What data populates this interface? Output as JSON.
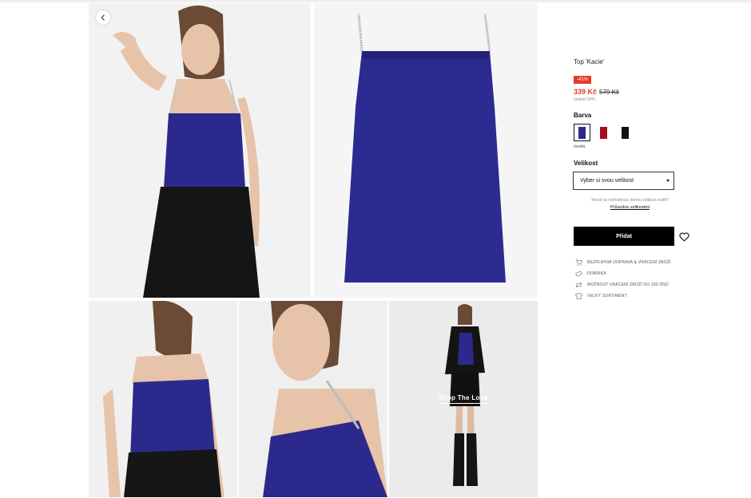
{
  "product": {
    "title": "Top 'Kacie'",
    "discount_badge": "-41%",
    "price_new": "339 Kč",
    "price_old": "579 Kč",
    "vat_note": "včetně DPH.",
    "accent_color": "#e8392b"
  },
  "color": {
    "label": "Barva",
    "selected_name": "modrá",
    "swatches": [
      {
        "name": "modrá",
        "hex": "#2b2a8c"
      },
      {
        "name": "červená",
        "hex": "#a3101c"
      },
      {
        "name": "černá",
        "hex": "#111111"
      }
    ]
  },
  "size": {
    "label": "Velikost",
    "select_value": "Vyber si svou velikost",
    "help_text": "Nevíš se rozhodnout, kterou velikost zvolit?",
    "help_link": "Průvodce velikostmi"
  },
  "actions": {
    "add_label": "Přidat"
  },
  "benefits": [
    {
      "icon": "cart-icon",
      "text": "BEZPLATNÁ DOPRAVA & VRÁCENÍ ZBOŽÍ"
    },
    {
      "icon": "cash-icon",
      "text": "DOBÍRKA"
    },
    {
      "icon": "return-arrows-icon",
      "text": "MOŽNOST VRÁCENÍ ZBOŽÍ DO 100 DNŮ"
    },
    {
      "icon": "shirt-icon",
      "text": "VELKÝ SORTIMENT"
    }
  ],
  "gallery": {
    "shop_the_look": "Shop The Look"
  }
}
